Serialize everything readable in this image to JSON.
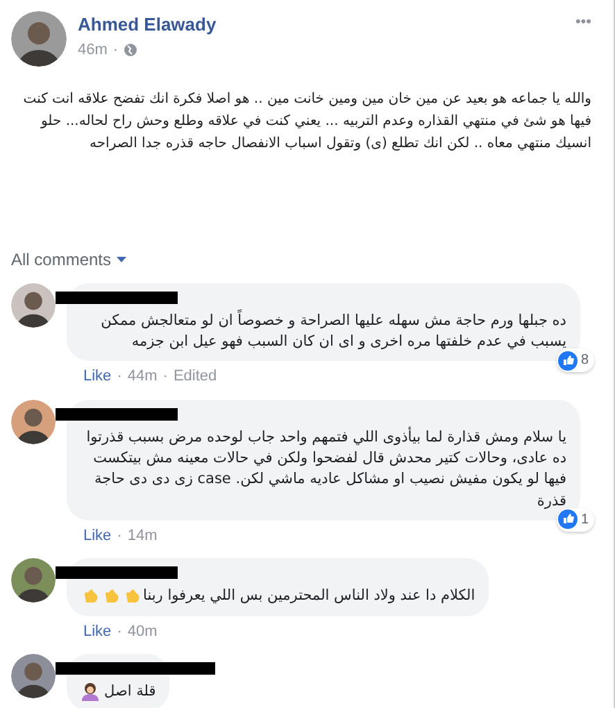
{
  "post": {
    "author": "Ahmed Elawady",
    "time": "46m",
    "separator": "·",
    "menu": "•••",
    "text": "والله يا جماعه هو بعيد عن مين خان مين ومين خانت مين .. هو اصلا فكرة انك تفضح علاقه انت كنت فيها هو شئ في منتهي القذاره وعدم التربيه ... يعني كنت في علاقه وطلع وحش راح لحاله... حلو انسيك منتهي معاه .. لكن انك تطلع (ى) وتقول اسباب الانفصال حاجه قذره جدا الصراحه"
  },
  "filter": {
    "label": "All comments"
  },
  "comments": [
    {
      "text": "ده جبلها ورم حاجة مش سهله عليها الصراحة و خصوصاً ان لو متعالجش ممكن يسبب في عدم خلفتها مره اخرى و اى ان كان السبب فهو عيل ابن جزمه",
      "reactions": "8",
      "like": "Like",
      "separator": "·",
      "time": "44m",
      "edited": "Edited"
    },
    {
      "text": "يا سلام ومش قذارة لما بيأذوى اللي فتمهم واحد جاب لوحده مرض بسبب قذرتوا ده عادى، وحالات كتير محدش قال لفضحوا ولكن في حالات معينه مش بيتكست فيها لو يكون مفيش نصيب او مشاكل عاديه ماشي لكن. case زى دى دى حاجة قذرة",
      "reactions": "1",
      "like": "Like",
      "separator": "·",
      "time": "14m"
    },
    {
      "text": "الكلام دا عند ولاد الناس المحترمين بس اللي يعرفوا ربنا",
      "emojis": [
        {
          "kind": "clap"
        },
        {
          "kind": "clap"
        },
        {
          "kind": "clap"
        }
      ],
      "like": "Like",
      "separator": "·",
      "time": "40m"
    },
    {
      "text": "قلة اصل",
      "emojis": [
        {
          "kind": "woman"
        }
      ]
    }
  ]
}
